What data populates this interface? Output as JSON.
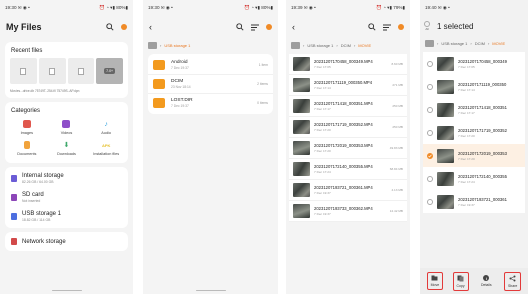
{
  "panel1": {
    "status_left": "19:30 ✉ ◉ •",
    "status_right": "⏰ ◔ ▾▮ 80%▮",
    "title": "My Files",
    "recent": {
      "header": "Recent files",
      "caption": "Movies...drive.db   75749T..254.fil   75749S..AP.dpn",
      "duration": "7.0+"
    },
    "categories": {
      "header": "Categories",
      "items": [
        {
          "label": "Images",
          "color": "#e0574d"
        },
        {
          "label": "Videos",
          "color": "#8e4fc9"
        },
        {
          "label": "Audio",
          "color": "#3ba6e0"
        },
        {
          "label": "Documents",
          "color": "#f1a33c"
        },
        {
          "label": "Downloads",
          "color": "#3fa86c"
        },
        {
          "label": "Installation files",
          "color": "#e6c12e",
          "tag": "APK"
        }
      ]
    },
    "storage": [
      {
        "name": "Internal storage",
        "sub": "82.26 GB / 64.00 GB",
        "color": "#6b5cd6"
      },
      {
        "name": "SD card",
        "sub": "Not inserted",
        "color": "#8c46b8"
      },
      {
        "name": "USB storage 1",
        "sub": "18.82 GB / 114 GB",
        "color": "#4d6fe0"
      }
    ],
    "network": {
      "name": "Network storage",
      "color": "#d24a4a"
    }
  },
  "panel2": {
    "status_left": "19:30 ✉ ◉ •",
    "status_right": "⏰ ◔ ▾▮ 80%▮",
    "crumb": "USB storage 1",
    "folders": [
      {
        "name": "Android",
        "date": "7 Dec 19:37",
        "meta": "1 item"
      },
      {
        "name": "DCIM",
        "date": "23 Nov 18:14",
        "meta": "2 items"
      },
      {
        "name": "LOST.DIR",
        "date": "7 Dec 19:37",
        "meta": "0 items"
      }
    ]
  },
  "panel3": {
    "status_left": "19:39 ✉ ◉ •",
    "status_right": "⏰ ◔ ▾▮ 79%▮",
    "crumbs": [
      "USB storage 1",
      "DCIM",
      "MOVIE"
    ],
    "files": [
      {
        "name": "20231207170458_000349.MP4",
        "date": "7 Dec 17:05",
        "size": "8.60 MB"
      },
      {
        "name": "20231207171119_000350.MP4",
        "date": "7 Dec 17:14",
        "size": "271 MB"
      },
      {
        "name": "20231207171418_000351.MP4",
        "date": "7 Dec 17:17",
        "size": "250 MB"
      },
      {
        "name": "20231207171719_000352.MP4",
        "date": "7 Dec 17:20",
        "size": "250 MB"
      },
      {
        "name": "20231207172019_000353.MP4",
        "date": "7 Dec 17:20",
        "size": "49.83 MB"
      },
      {
        "name": "20231207172140_000355.MP4",
        "date": "7 Dec 17:24",
        "size": "68.84 MB"
      },
      {
        "name": "20231207193721_000361.MP4",
        "date": "7 Dec 19:37",
        "size": "4.13 MB"
      },
      {
        "name": "20231207193733_000362.MP4",
        "date": "7 Dec 19:37",
        "size": "12.42 MB"
      }
    ]
  },
  "panel4": {
    "status_left": "19:40 ✉ ◉ •",
    "all_label": "All",
    "title": "1 selected",
    "crumbs": [
      "USB storage 1",
      "DCIM",
      "MOVIE"
    ],
    "files": [
      {
        "name": "20231207170458_000349",
        "date": "7 Dec 17:05"
      },
      {
        "name": "20231207171119_000350",
        "date": "7 Dec 17:14"
      },
      {
        "name": "20231207171418_000351",
        "date": "7 Dec 17:17"
      },
      {
        "name": "20231207171719_000352",
        "date": "7 Dec 17:20"
      },
      {
        "name": "20231207172019_000353",
        "date": "7 Dec 17:20"
      },
      {
        "name": "20231207172140_000355",
        "date": "7 Dec 17:24"
      },
      {
        "name": "20231207193721_000361",
        "date": "7 Dec 19:37"
      }
    ],
    "selected_index": 4,
    "actions": [
      {
        "label": "Move",
        "icon": "move-icon"
      },
      {
        "label": "Copy",
        "icon": "copy-icon"
      },
      {
        "label": "Details",
        "icon": "info-icon"
      },
      {
        "label": "Share",
        "icon": "share-icon"
      }
    ],
    "accent": "#f08a26",
    "highlight": "#e23a3a"
  }
}
